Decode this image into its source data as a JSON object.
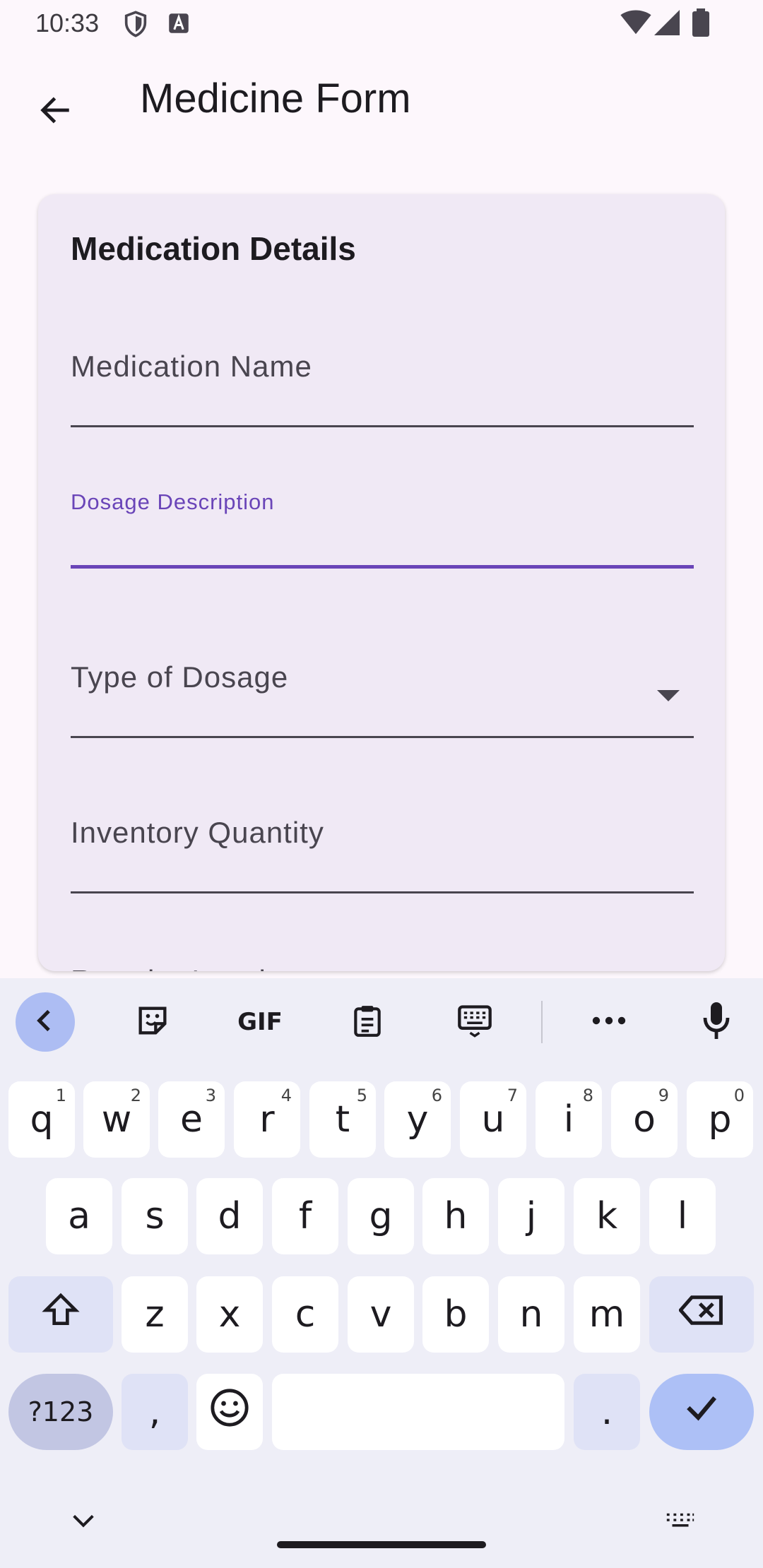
{
  "status_bar": {
    "time": "10:33",
    "icons": [
      "shield-icon",
      "a-box-icon",
      "wifi-icon",
      "signal-icon",
      "battery-icon"
    ]
  },
  "app_bar": {
    "title": "Medicine Form",
    "back_icon": "arrow-back-icon"
  },
  "card": {
    "title": "Medication Details",
    "fields": {
      "medication_name": {
        "label": "Medication Name",
        "value": ""
      },
      "dosage_description": {
        "label": "Dosage Description",
        "value": "",
        "focused": true
      },
      "type_of_dosage": {
        "label": "Type of Dosage",
        "value": ""
      },
      "inventory_quantity": {
        "label": "Inventory Quantity",
        "value": ""
      },
      "next_field_partial": {
        "label": "Reorder Level"
      }
    }
  },
  "keyboard": {
    "toolbar": [
      "back-chevron-icon",
      "sticker-icon",
      "gif-icon",
      "clipboard-icon",
      "keyboard-icon",
      "more-icon",
      "mic-icon"
    ],
    "gif_label": "GIF",
    "row1": [
      {
        "k": "q",
        "h": "1"
      },
      {
        "k": "w",
        "h": "2"
      },
      {
        "k": "e",
        "h": "3"
      },
      {
        "k": "r",
        "h": "4"
      },
      {
        "k": "t",
        "h": "5"
      },
      {
        "k": "y",
        "h": "6"
      },
      {
        "k": "u",
        "h": "7"
      },
      {
        "k": "i",
        "h": "8"
      },
      {
        "k": "o",
        "h": "9"
      },
      {
        "k": "p",
        "h": "0"
      }
    ],
    "row2": [
      "a",
      "s",
      "d",
      "f",
      "g",
      "h",
      "j",
      "k",
      "l"
    ],
    "row3": [
      "z",
      "x",
      "c",
      "v",
      "b",
      "n",
      "m"
    ],
    "row4": {
      "symbols": "?123",
      "comma": ",",
      "period": "."
    }
  },
  "colors": {
    "accent": "#6a45b8",
    "card_bg": "#f0e9f5",
    "page_bg": "#fdf7fc",
    "keyboard_bg": "#eeeef7",
    "enter_key": "#adc0f6"
  }
}
